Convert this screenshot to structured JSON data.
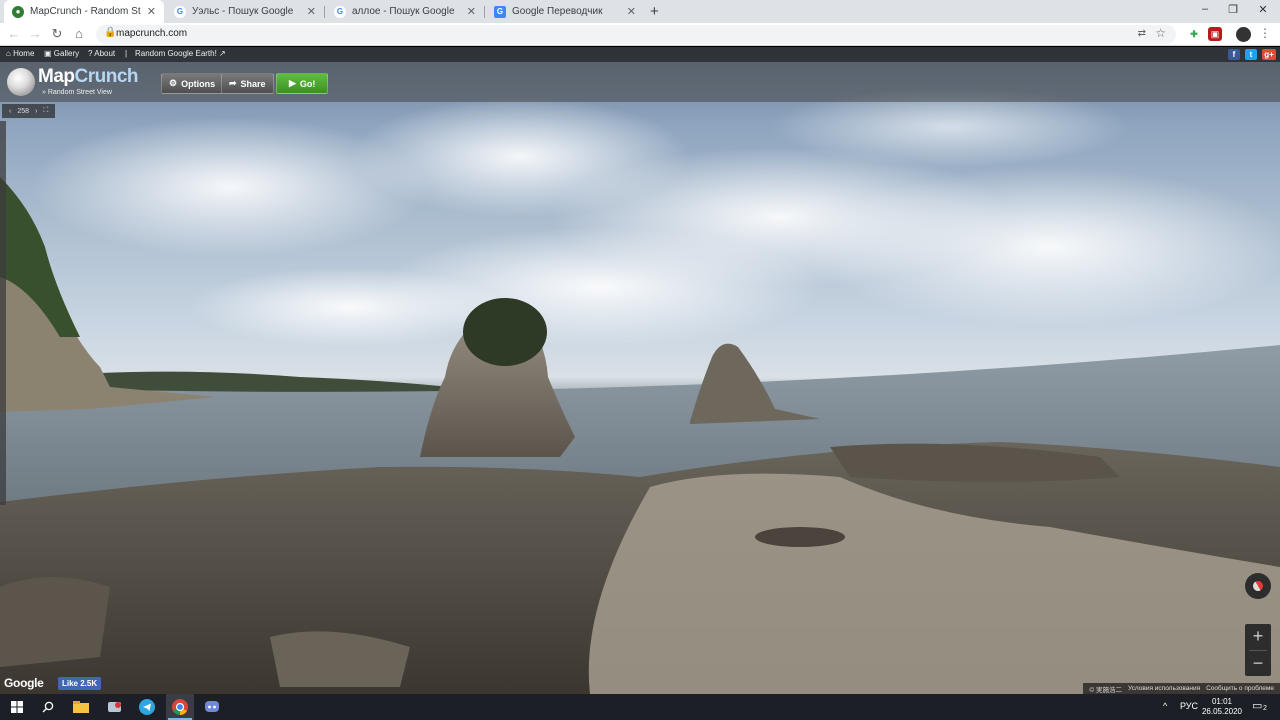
{
  "browser": {
    "tabs": [
      {
        "title": "MapCrunch - Random Street View",
        "close": "✕",
        "icon": "mapcrunch-favicon"
      },
      {
        "title": "Уэльс - Пошук Google",
        "close": "✕",
        "icon": "google-favicon"
      },
      {
        "title": "аллое - Пошук Google",
        "close": "✕",
        "icon": "google-favicon"
      },
      {
        "title": "Google Переводчик",
        "close": "✕",
        "icon": "google-translate-favicon"
      }
    ],
    "new_tab": "+",
    "window_controls": {
      "minimize": "–",
      "restore": "❐",
      "close": "✕"
    },
    "nav": {
      "back": "←",
      "forward": "→",
      "reload": "↻",
      "home": "⌂"
    },
    "url": "mapcrunch.com",
    "menu": "⋮"
  },
  "mapcrunch": {
    "topbar": {
      "home": "Home",
      "gallery": "Gallery",
      "about": "About",
      "separator": "|",
      "random_earth": "Random Google Earth!"
    },
    "social": {
      "facebook": "f",
      "twitter": "t",
      "googleplus": "g+"
    },
    "logo": {
      "map": "Map",
      "crunch": "Crunch",
      "tagline": "» Random Street View"
    },
    "buttons": {
      "options": "Options",
      "share": "Share",
      "go": "Go!"
    },
    "counter": {
      "prev": "‹",
      "value": "258",
      "next": "›",
      "extra": "⛶"
    }
  },
  "streetview": {
    "google_logo": "Google",
    "like": "Like 2.5K",
    "footer": [
      "© 実施浩二",
      "Условия использования",
      "Сообщить о проблеме"
    ],
    "zoom_in": "+",
    "zoom_out": "−"
  },
  "taskbar": {
    "language": "РУС",
    "time": "01:01",
    "date": "26.05.2020",
    "tray_chevron": "^",
    "notifications": "2"
  }
}
